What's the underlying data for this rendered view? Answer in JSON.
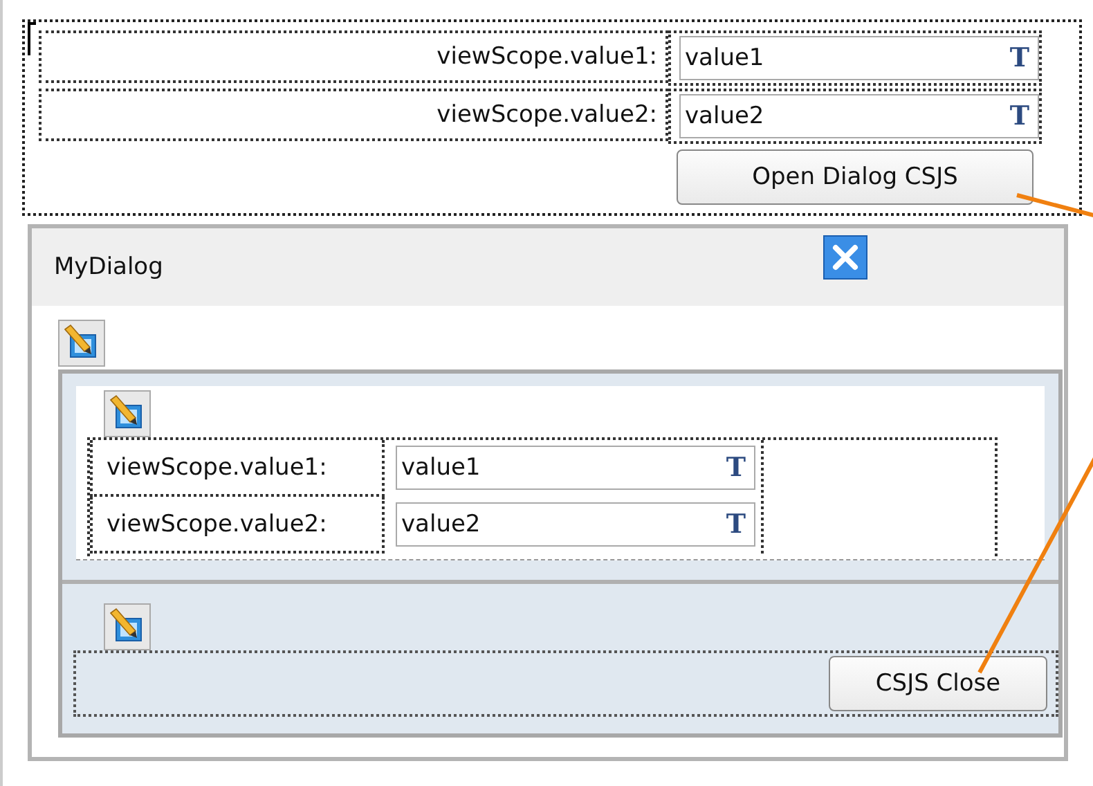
{
  "page": {
    "fields": [
      {
        "label": "viewScope.value1:",
        "value": "value1",
        "icon": "T"
      },
      {
        "label": "viewScope.value2:",
        "value": "value2",
        "icon": "T"
      }
    ],
    "button": "Open Dialog CSJS"
  },
  "dialog": {
    "title": "MyDialog",
    "content_fields": [
      {
        "label": "viewScope.value1:",
        "value": "value1",
        "icon": "T"
      },
      {
        "label": "viewScope.value2:",
        "value": "value2",
        "icon": "T"
      }
    ],
    "footer_button": "CSJS Close"
  }
}
